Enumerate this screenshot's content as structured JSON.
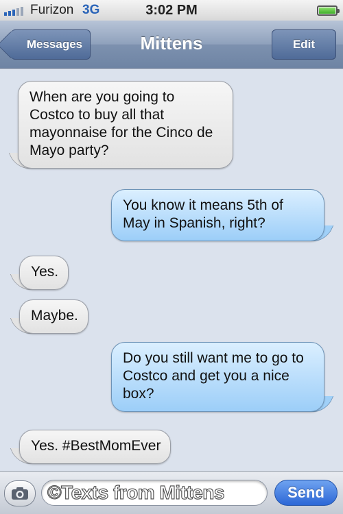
{
  "status_bar": {
    "carrier": "Furizon",
    "network": "3G",
    "time": "3:02 PM",
    "battery_level": 1.0
  },
  "nav": {
    "back_label": "Messages",
    "title": "Mittens",
    "edit_label": "Edit"
  },
  "messages": [
    {
      "direction": "incoming",
      "text": "When are you going to Costco to buy all that mayonnaise for the Cinco de Mayo party?"
    },
    {
      "direction": "outgoing",
      "text": "You know it means 5th of May in Spanish, right?"
    },
    {
      "direction": "incoming",
      "text": "Yes."
    },
    {
      "direction": "incoming",
      "text": "Maybe."
    },
    {
      "direction": "outgoing",
      "text": "Do you still want me to go to Costco and get you a nice box?"
    },
    {
      "direction": "incoming",
      "text": "Yes. #BestMomEver"
    }
  ],
  "compose": {
    "camera_icon": "camera-icon",
    "watermark": "©Texts from Mittens",
    "send_label": "Send"
  },
  "colors": {
    "background": "#dbe2ed",
    "incoming_bubble": "#e8e8e8",
    "outgoing_bubble": "#9ccef8",
    "accent_blue": "#2c67d6"
  }
}
